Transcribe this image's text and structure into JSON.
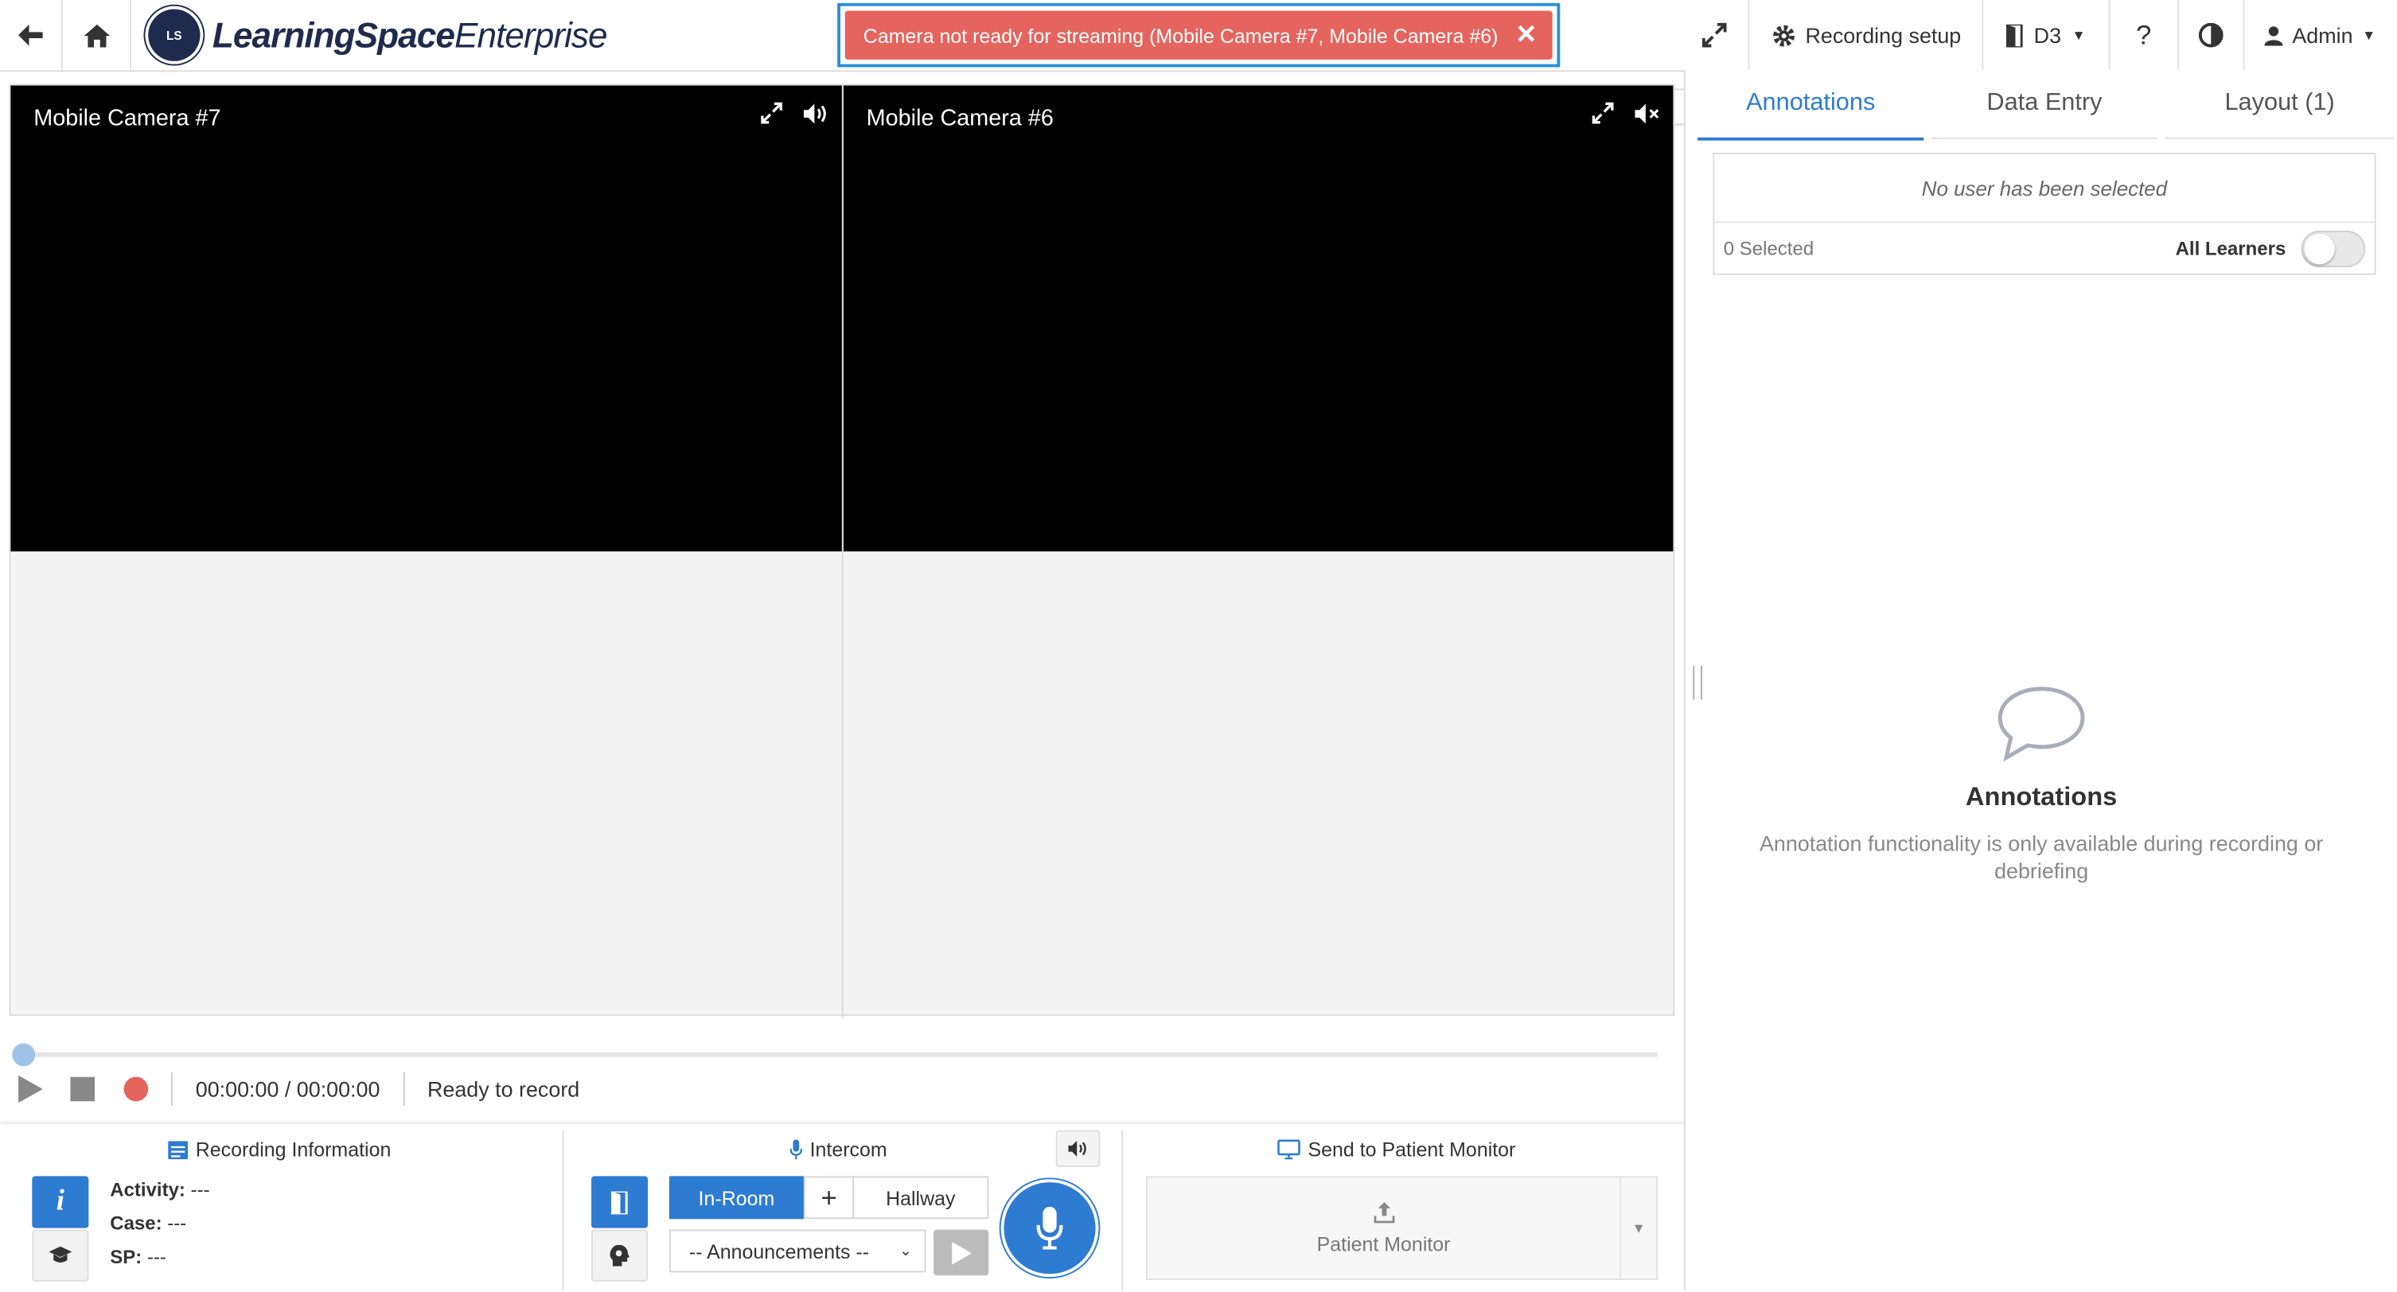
{
  "app": {
    "logo_mark": "LS",
    "logo_bold": "LearningSpace",
    "logo_rest": "Enterprise"
  },
  "alert": {
    "message": "Camera not ready for streaming (Mobile Camera #7, Mobile Camera #6)",
    "close": "✕",
    "color": "#e5645e"
  },
  "topbar": {
    "recording_setup": "Recording setup",
    "room": "D3",
    "help": "?",
    "user": "Admin"
  },
  "cameras": [
    {
      "title": "Mobile Camera #7",
      "audio": "on"
    },
    {
      "title": "Mobile Camera #6",
      "audio": "muted"
    }
  ],
  "player": {
    "progress": 0,
    "time": "00:00:00 / 00:00:00",
    "status": "Ready to record",
    "record_color": "#e5645e"
  },
  "recording_info": {
    "title": "Recording Information",
    "activity_label": "Activity:",
    "activity_value": "---",
    "case_label": "Case:",
    "case_value": "---",
    "sp_label": "SP:",
    "sp_value": "---"
  },
  "intercom": {
    "title": "Intercom",
    "in_room": "In-Room",
    "plus": "+",
    "hallway": "Hallway",
    "announcements": "-- Announcements --"
  },
  "patient_monitor": {
    "title": "Send to Patient Monitor",
    "label": "Patient Monitor"
  },
  "right_panel": {
    "tabs": [
      "Annotations",
      "Data Entry",
      "Layout (1)"
    ],
    "no_user": "No user has been selected",
    "selected": "0 Selected",
    "all_learners": "All Learners",
    "all_learners_on": false,
    "empty_title": "Annotations",
    "empty_text": "Annotation functionality is only available during recording or debriefing"
  },
  "colors": {
    "accent": "#2e7bd2",
    "brand": "#1f2b4d"
  }
}
